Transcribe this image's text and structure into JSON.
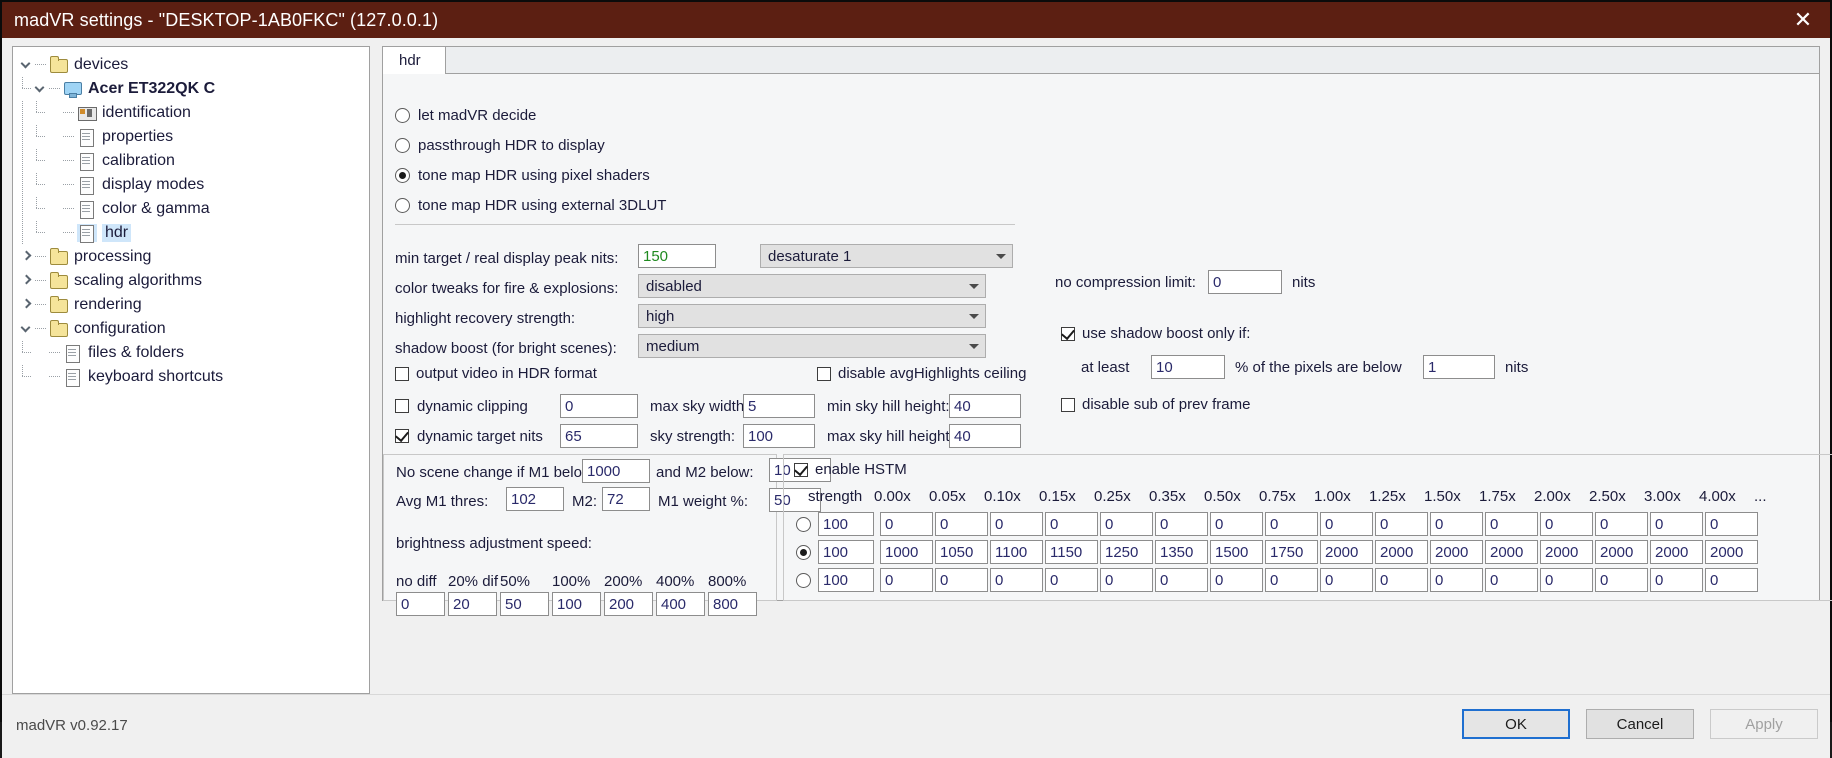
{
  "window": {
    "title": "madVR settings - \"DESKTOP-1AB0FKC\" (127.0.0.1)",
    "close_glyph": "✕",
    "accent_titlebar": "#5c1f12",
    "version": "madVR v0.92.17"
  },
  "tree": [
    {
      "label": "devices",
      "depth": 0,
      "icon": "folder",
      "expander": "down",
      "bold": false,
      "selected": false
    },
    {
      "label": "Acer ET322QK C",
      "depth": 1,
      "icon": "monitor",
      "expander": "down",
      "bold": true,
      "selected": false
    },
    {
      "label": "identification",
      "depth": 2,
      "icon": "idcard",
      "expander": "none",
      "bold": false,
      "selected": false
    },
    {
      "label": "properties",
      "depth": 2,
      "icon": "page",
      "expander": "none",
      "bold": false,
      "selected": false
    },
    {
      "label": "calibration",
      "depth": 2,
      "icon": "page",
      "expander": "none",
      "bold": false,
      "selected": false
    },
    {
      "label": "display modes",
      "depth": 2,
      "icon": "page",
      "expander": "none",
      "bold": false,
      "selected": false
    },
    {
      "label": "color & gamma",
      "depth": 2,
      "icon": "page",
      "expander": "none",
      "bold": false,
      "selected": false
    },
    {
      "label": "hdr",
      "depth": 2,
      "icon": "page",
      "expander": "none",
      "bold": false,
      "selected": true
    },
    {
      "label": "processing",
      "depth": 0,
      "icon": "folder",
      "expander": "right",
      "bold": false,
      "selected": false
    },
    {
      "label": "scaling algorithms",
      "depth": 0,
      "icon": "folder",
      "expander": "right",
      "bold": false,
      "selected": false
    },
    {
      "label": "rendering",
      "depth": 0,
      "icon": "folder",
      "expander": "right",
      "bold": false,
      "selected": false
    },
    {
      "label": "configuration",
      "depth": 0,
      "icon": "folder",
      "expander": "down",
      "bold": false,
      "selected": false
    },
    {
      "label": "files & folders",
      "depth": 1,
      "icon": "page",
      "expander": "none",
      "bold": false,
      "selected": false
    },
    {
      "label": "keyboard shortcuts",
      "depth": 1,
      "icon": "page",
      "expander": "none",
      "bold": false,
      "selected": false
    }
  ],
  "tab": {
    "label": "hdr"
  },
  "hdr_mode": {
    "options": [
      {
        "label": "let madVR decide",
        "selected": false
      },
      {
        "label": "passthrough HDR to display",
        "selected": false
      },
      {
        "label": "tone map HDR using pixel shaders",
        "selected": true
      },
      {
        "label": "tone map HDR using external 3DLUT",
        "selected": false
      }
    ]
  },
  "settings": {
    "min_target_label": "min target / real display peak nits:",
    "min_target_value": "150",
    "desaturate_combo": "desaturate 1",
    "color_tweaks_label": "color tweaks for fire & explosions:",
    "color_tweaks_value": "disabled",
    "highlight_recovery_label": "highlight recovery strength:",
    "highlight_recovery_value": "high",
    "shadow_boost_label": "shadow boost (for bright scenes):",
    "shadow_boost_value": "medium",
    "output_hdr_label": "output video in HDR format",
    "output_hdr_checked": false,
    "disable_avg_label": "disable avgHighlights ceiling",
    "disable_avg_checked": false,
    "dynamic_clipping_label": "dynamic clipping",
    "dynamic_clipping_checked": false,
    "dynamic_clipping_value": "0",
    "max_sky_width_label": "max sky width:",
    "max_sky_width_value": "5",
    "min_sky_hill_label": "min sky hill height:",
    "min_sky_hill_value": "40",
    "dynamic_target_label": "dynamic target nits",
    "dynamic_target_checked": true,
    "dynamic_target_value": "65",
    "sky_strength_label": "sky strength:",
    "sky_strength_value": "100",
    "max_sky_hill_label": "max sky hill height:",
    "max_sky_hill_value": "40"
  },
  "right_col": {
    "no_compression_label": "no compression limit:",
    "no_compression_value": "0",
    "no_compression_unit": "nits",
    "use_shadow_boost_label": "use shadow boost only if:",
    "use_shadow_boost_checked": true,
    "at_least_label": "at least",
    "at_least_value": "10",
    "pixels_below_label": "% of the pixels are below",
    "pixels_below_value": "1",
    "pixels_below_unit": "nits",
    "disable_sub_label": "disable sub of prev frame",
    "disable_sub_checked": false
  },
  "scene": {
    "no_scene_label": "No scene change if M1 below:",
    "m1_below_value": "1000",
    "and_m2_label": "and M2 below:",
    "m2_below_value": "10",
    "avg_m1_label": "Avg M1 thres:",
    "avg_m1_value": "102",
    "m2_label": "M2:",
    "m2_value": "72",
    "m1_weight_label": "M1 weight %:",
    "m1_weight_value": "50",
    "brightness_speed_label": "brightness adjustment speed:",
    "speed_headers": [
      "no diff",
      "20% dif",
      "50%",
      "100%",
      "200%",
      "400%",
      "800%"
    ],
    "speed_values": [
      "0",
      "20",
      "50",
      "100",
      "200",
      "400",
      "800"
    ]
  },
  "hstm": {
    "enable_label": "enable HSTM",
    "enable_checked": true,
    "strength_label": "strength",
    "columns": [
      "0.00x",
      "0.05x",
      "0.10x",
      "0.15x",
      "0.25x",
      "0.35x",
      "0.50x",
      "0.75x",
      "1.00x",
      "1.25x",
      "1.50x",
      "1.75x",
      "2.00x",
      "2.50x",
      "3.00x",
      "4.00x"
    ],
    "columns_overflow": "...",
    "rows": [
      {
        "selected": false,
        "strength": "100",
        "values": [
          "0",
          "0",
          "0",
          "0",
          "0",
          "0",
          "0",
          "0",
          "0",
          "0",
          "0",
          "0",
          "0",
          "0",
          "0",
          "0"
        ]
      },
      {
        "selected": true,
        "strength": "100",
        "values": [
          "1000",
          "1050",
          "1100",
          "1150",
          "1250",
          "1350",
          "1500",
          "1750",
          "2000",
          "2000",
          "2000",
          "2000",
          "2000",
          "2000",
          "2000",
          "2000"
        ]
      },
      {
        "selected": false,
        "strength": "100",
        "values": [
          "0",
          "0",
          "0",
          "0",
          "0",
          "0",
          "0",
          "0",
          "0",
          "0",
          "0",
          "0",
          "0",
          "0",
          "0",
          "0"
        ]
      }
    ]
  },
  "buttons": {
    "ok": "OK",
    "cancel": "Cancel",
    "apply": "Apply"
  }
}
